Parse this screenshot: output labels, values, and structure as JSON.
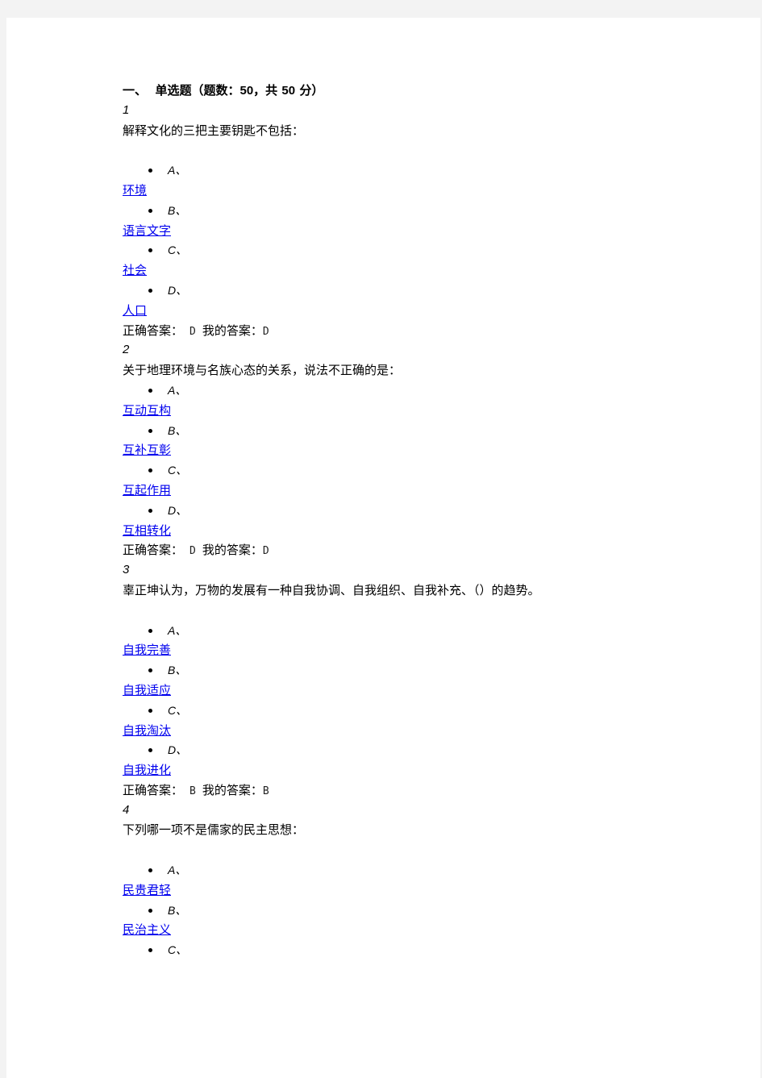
{
  "section": {
    "prefix": "一、",
    "title_a": "单选题（题数：",
    "count": "50",
    "title_b": "，共",
    "score": "50",
    "title_c": "分）"
  },
  "labels": {
    "correct_answer": "正确答案：",
    "my_answer": "我的答案："
  },
  "questions": [
    {
      "number": "1",
      "text": "解释文化的三把主要钥匙不包括：",
      "options": [
        {
          "letter": "A、",
          "text": "环境"
        },
        {
          "letter": "B、",
          "text": "语言文字"
        },
        {
          "letter": "C、",
          "text": "社会"
        },
        {
          "letter": "D、",
          "text": "人口"
        }
      ],
      "correct": "D",
      "mine": "D"
    },
    {
      "number": "2",
      "text": "关于地理环境与名族心态的关系，说法不正确的是：",
      "options": [
        {
          "letter": "A、",
          "text": "互动互构"
        },
        {
          "letter": "B、",
          "text": "互补互彰"
        },
        {
          "letter": "C、",
          "text": "互起作用"
        },
        {
          "letter": "D、",
          "text": "互相转化"
        }
      ],
      "correct": "D",
      "mine": "D"
    },
    {
      "number": "3",
      "text": "辜正坤认为，万物的发展有一种自我协调、自我组织、自我补充、（）的趋势。",
      "options": [
        {
          "letter": "A、",
          "text": "自我完善"
        },
        {
          "letter": "B、",
          "text": "自我适应"
        },
        {
          "letter": "C、",
          "text": "自我淘汰"
        },
        {
          "letter": "D、",
          "text": "自我进化"
        }
      ],
      "correct": "B",
      "mine": "B"
    },
    {
      "number": "4",
      "text": "下列哪一项不是儒家的民主思想：",
      "options": [
        {
          "letter": "A、",
          "text": "民贵君轻"
        },
        {
          "letter": "B、",
          "text": "民治主义"
        },
        {
          "letter": "C、",
          "text": ""
        }
      ]
    }
  ]
}
